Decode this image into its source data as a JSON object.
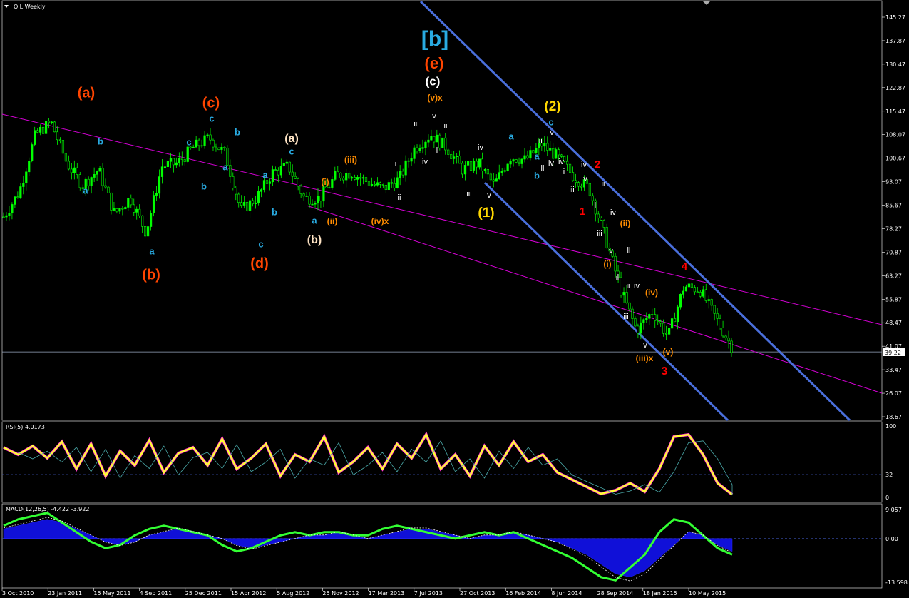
{
  "chart_data": {
    "type": "candlestick",
    "title": "OIL,Weekly",
    "symbol_period": "OIL,Weekly",
    "last_price": "39.22",
    "y_ticks": [
      "145.27",
      "137.87",
      "130.47",
      "122.87",
      "115.47",
      "108.07",
      "100.67",
      "93.07",
      "85.67",
      "78.27",
      "70.87",
      "63.27",
      "55.87",
      "48.47",
      "41.07",
      "33.47",
      "26.07",
      "18.67"
    ],
    "x_ticks": [
      "3 Oct 2010",
      "23 Jan 2011",
      "15 May 2011",
      "4 Sep 2011",
      "25 Dec 2011",
      "15 Apr 2012",
      "5 Aug 2012",
      "25 Nov 2012",
      "17 Mar 2013",
      "7 Jul 2013",
      "27 Oct 2013",
      "16 Feb 2014",
      "8 Jun 2014",
      "28 Sep 2014",
      "18 Jan 2015",
      "10 May 2015"
    ],
    "ylim": [
      18.67,
      145.27
    ],
    "price_path": [
      [
        "3 Oct 2010",
        82
      ],
      [
        "23 Jan 2011",
        90
      ],
      [
        "Mar 2011",
        108
      ],
      [
        "Apr 2011",
        112
      ],
      [
        "15 May 2011",
        99
      ],
      [
        "Jun 2011",
        92
      ],
      [
        "Jul 2011",
        97
      ],
      [
        "Aug 2011",
        83
      ],
      [
        "4 Sep 2011",
        88
      ],
      [
        "Oct 2011",
        77
      ],
      [
        "Nov 2011",
        98
      ],
      [
        "25 Dec 2011",
        99
      ],
      [
        "Feb 2012",
        104
      ],
      [
        "Mar 2012",
        107
      ],
      [
        "15 Apr 2012",
        102
      ],
      [
        "Jun 2012",
        84
      ],
      [
        "Jul 2012",
        88
      ],
      [
        "5 Aug 2012",
        96
      ],
      [
        "Sep 2012",
        98
      ],
      [
        "Oct 2012",
        88
      ],
      [
        "25 Nov 2012",
        88
      ],
      [
        "Jan 2013",
        95
      ],
      [
        "Feb 2013",
        96
      ],
      [
        "17 Mar 2013",
        93
      ],
      [
        "Apr 2013",
        91
      ],
      [
        "May 2013",
        94
      ],
      [
        "7 Jul 2013",
        104
      ],
      [
        "Aug 2013",
        108
      ],
      [
        "Sep 2013",
        104
      ],
      [
        "27 Oct 2013",
        97
      ],
      [
        "Dec 2013",
        99
      ],
      [
        "Jan 2014",
        92
      ],
      [
        "16 Feb 2014",
        101
      ],
      [
        "Apr 2014",
        100
      ],
      [
        "8 Jun 2014",
        105
      ],
      [
        "Jul 2014",
        101
      ],
      [
        "Aug 2014",
        95
      ],
      [
        "28 Sep 2014",
        91
      ],
      [
        "Nov 2014",
        76
      ],
      [
        "Dec 2014",
        59
      ],
      [
        "18 Jan 2015",
        46
      ],
      [
        "Feb 2015",
        52
      ],
      [
        "Mar 2015",
        44
      ],
      [
        "10 May 2015",
        60
      ],
      [
        "Jun 2015",
        59
      ],
      [
        "Jul 2015",
        50
      ],
      [
        "Aug 2015",
        41
      ]
    ],
    "wave_labels": [
      {
        "text": "[b]",
        "color": "#29abe2"
      },
      {
        "text": "(e)",
        "color": "#ff4500"
      },
      {
        "text": "(c)",
        "color": "#ffffff"
      },
      {
        "text": "(v)x",
        "color": "#ff8c00"
      },
      {
        "text": "(a)",
        "color": "#ff4500"
      },
      {
        "text": "(b)",
        "color": "#ff4500"
      },
      {
        "text": "(c)",
        "color": "#ff4500"
      },
      {
        "text": "(d)",
        "color": "#ff4500"
      },
      {
        "text": "(a)",
        "color": "#ffe4c4"
      },
      {
        "text": "(b)",
        "color": "#ffe4c4"
      },
      {
        "text": "(i)",
        "color": "#ff8c00"
      },
      {
        "text": "(ii)",
        "color": "#ff8c00"
      },
      {
        "text": "(iii)",
        "color": "#ff8c00"
      },
      {
        "text": "(iv)x",
        "color": "#ff8c00"
      },
      {
        "text": "(1)",
        "color": "#ffd700"
      },
      {
        "text": "(2)",
        "color": "#ffd700"
      },
      {
        "text": "1",
        "color": "#ff0000"
      },
      {
        "text": "2",
        "color": "#ff0000"
      },
      {
        "text": "3",
        "color": "#ff0000"
      },
      {
        "text": "4",
        "color": "#ff0000"
      },
      {
        "text": "(i)",
        "color": "#ff8c00"
      },
      {
        "text": "(ii)",
        "color": "#ff8c00"
      },
      {
        "text": "(iii)x",
        "color": "#ff8c00"
      },
      {
        "text": "(iv)",
        "color": "#ff8c00"
      },
      {
        "text": "(v)",
        "color": "#ff8c00"
      },
      {
        "text": "a",
        "color": "#29abe2"
      },
      {
        "text": "b",
        "color": "#29abe2"
      },
      {
        "text": "a",
        "color": "#29abe2"
      },
      {
        "text": "c",
        "color": "#29abe2"
      },
      {
        "text": "c",
        "color": "#29abe2"
      },
      {
        "text": "b",
        "color": "#29abe2"
      },
      {
        "text": "a",
        "color": "#29abe2"
      },
      {
        "text": "b",
        "color": "#29abe2"
      },
      {
        "text": "a",
        "color": "#29abe2"
      },
      {
        "text": "c",
        "color": "#29abe2"
      },
      {
        "text": "b",
        "color": "#29abe2"
      },
      {
        "text": "a",
        "color": "#29abe2"
      },
      {
        "text": "c",
        "color": "#29abe2"
      },
      {
        "text": "a",
        "color": "#29abe2"
      },
      {
        "text": "a",
        "color": "#29abe2"
      },
      {
        "text": "b",
        "color": "#29abe2"
      },
      {
        "text": "c",
        "color": "#29abe2"
      },
      {
        "text": "iii",
        "color": "#ffffff"
      },
      {
        "text": "v",
        "color": "#ffffff"
      },
      {
        "text": "ii",
        "color": "#ffffff"
      },
      {
        "text": "i",
        "color": "#ffffff"
      },
      {
        "text": "iv",
        "color": "#ffffff"
      },
      {
        "text": "i",
        "color": "#ffffff"
      },
      {
        "text": "ii",
        "color": "#ffffff"
      },
      {
        "text": "iii",
        "color": "#ffffff"
      },
      {
        "text": "iv",
        "color": "#ffffff"
      },
      {
        "text": "v",
        "color": "#ffffff"
      },
      {
        "text": "iii",
        "color": "#ffffff"
      },
      {
        "text": "ii",
        "color": "#ffffff"
      },
      {
        "text": "iv",
        "color": "#ffffff"
      },
      {
        "text": "iv",
        "color": "#ffffff"
      },
      {
        "text": "i",
        "color": "#ffffff"
      },
      {
        "text": "v",
        "color": "#ffffff"
      },
      {
        "text": "iii",
        "color": "#ffffff"
      },
      {
        "text": "iv",
        "color": "#ffffff"
      },
      {
        "text": "ii",
        "color": "#ffffff"
      },
      {
        "text": "i",
        "color": "#ffffff"
      },
      {
        "text": "v",
        "color": "#ffffff"
      },
      {
        "text": "i",
        "color": "#ffffff"
      },
      {
        "text": "iii",
        "color": "#ffffff"
      },
      {
        "text": "ii",
        "color": "#ffffff"
      },
      {
        "text": "iv",
        "color": "#ffffff"
      },
      {
        "text": "ii",
        "color": "#ffffff"
      },
      {
        "text": "iii",
        "color": "#ffffff"
      },
      {
        "text": "i",
        "color": "#ffffff"
      },
      {
        "text": "v",
        "color": "#ffffff"
      },
      {
        "text": "iv",
        "color": "#ffffff"
      },
      {
        "text": "v",
        "color": "#ffffff"
      }
    ],
    "rsi": {
      "title": "RSI(5) 4.0173",
      "levels": [
        "100",
        "32",
        "0"
      ],
      "values": [
        70,
        60,
        72,
        55,
        78,
        40,
        75,
        30,
        65,
        45,
        80,
        35,
        62,
        70,
        45,
        82,
        40,
        55,
        75,
        30,
        60,
        50,
        85,
        35,
        50,
        70,
        40,
        75,
        55,
        88,
        40,
        60,
        30,
        72,
        45,
        78,
        50,
        60,
        35,
        25,
        15,
        5,
        10,
        20,
        8,
        40,
        85,
        88,
        60,
        20,
        4
      ]
    },
    "macd": {
      "title": "MACD(12,26,5) -4.422 -3.922",
      "levels": [
        "9.057",
        "0.00",
        "-13.598"
      ],
      "hist": [
        3,
        4,
        5,
        6,
        5,
        3,
        1,
        -1,
        -2,
        -1,
        1,
        2,
        3,
        2,
        1,
        0,
        -2,
        -3,
        -2,
        -1,
        0,
        1,
        1,
        2,
        1,
        0,
        1,
        2,
        3,
        3,
        2,
        1,
        0,
        1,
        1,
        2,
        1,
        0,
        -1,
        -3,
        -5,
        -8,
        -11,
        -12,
        -10,
        -6,
        -2,
        2,
        1,
        -2,
        -4
      ],
      "signal": [
        4,
        6,
        7,
        8,
        5,
        2,
        -1,
        -3,
        -2,
        1,
        3,
        4,
        3,
        2,
        1,
        -2,
        -4,
        -3,
        -1,
        1,
        2,
        1,
        2,
        2,
        1,
        1,
        3,
        4,
        3,
        2,
        1,
        0,
        1,
        2,
        1,
        2,
        0,
        -2,
        -4,
        -6,
        -9,
        -12,
        -13,
        -9,
        -5,
        2,
        6,
        5,
        1,
        -3,
        -5
      ]
    },
    "trendlines": [
      {
        "name": "upper-magenta",
        "color": "#d400d4"
      },
      {
        "name": "lower-magenta",
        "color": "#d400d4"
      },
      {
        "name": "upper-blue-channel",
        "color": "#4a6fdc"
      },
      {
        "name": "lower-blue-channel",
        "color": "#4a6fdc"
      }
    ],
    "colors": {
      "bull": "#00ff00",
      "bear": "#ffffff",
      "bg": "#000000"
    }
  }
}
